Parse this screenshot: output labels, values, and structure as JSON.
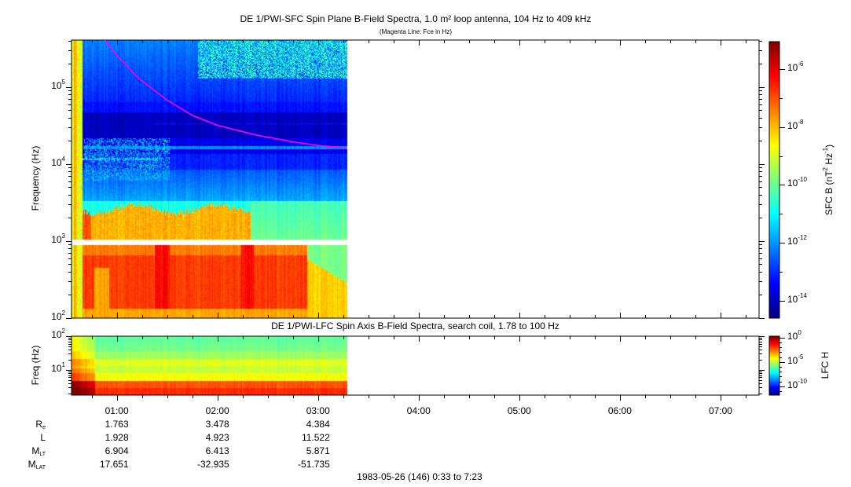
{
  "chart_data": [
    {
      "type": "heatmap",
      "title": "DE 1/PWI-SFC  Spin Plane B-Field Spectra, 1.0 m² loop antenna, 104 Hz to 409 kHz",
      "subtitle": "(Magenta Line: Fce in Hz)",
      "ylabel": "Frequency (Hz)",
      "yscale": "log",
      "ylim": [
        100,
        409000
      ],
      "yticks": [
        {
          "base": "10",
          "exp": "2",
          "value": 100
        },
        {
          "base": "10",
          "exp": "3",
          "value": 1000
        },
        {
          "base": "10",
          "exp": "4",
          "value": 10000
        },
        {
          "base": "10",
          "exp": "5",
          "value": 100000
        }
      ],
      "data_time_range_hours": [
        0.55,
        3.29
      ],
      "colorbar": {
        "label": "SFC B (nT",
        "label_sup1": "2",
        "label_mid": " Hz",
        "label_sup2": "-1",
        "label_end": ")",
        "scale": "log",
        "range_log10": [
          -14.6,
          -5.05
        ],
        "ticks": [
          {
            "base": "10",
            "exp": "-6",
            "value": -6
          },
          {
            "base": "10",
            "exp": "-8",
            "value": -8
          },
          {
            "base": "10",
            "exp": "-10",
            "value": -10
          },
          {
            "base": "10",
            "exp": "-12",
            "value": -12
          },
          {
            "base": "10",
            "exp": "-14",
            "value": -14
          }
        ]
      },
      "fce_line": {
        "color": "#ff00ff",
        "time_hours": [
          0.88,
          1.0,
          1.22,
          1.5,
          1.75,
          2.0,
          2.38,
          2.75,
          3.0,
          3.28
        ],
        "freq_hz": [
          409000,
          260000,
          129000,
          68000,
          43000,
          32000,
          24000,
          19500,
          17500,
          16300
        ]
      }
    },
    {
      "type": "heatmap",
      "title": "DE 1/PWI-LFC  Spin Axis B-Field Spectra, search coil, 1.78 to 100 Hz",
      "ylabel": "Freq (Hz)",
      "yscale": "log",
      "ylim": [
        1.78,
        100
      ],
      "yticks": [
        {
          "base": "10",
          "exp": "1",
          "value": 10
        },
        {
          "base": "10",
          "exp": "2",
          "value": 100
        }
      ],
      "data_time_range_hours": [
        0.55,
        3.29
      ],
      "colorbar": {
        "label": "LFC H",
        "scale": "log",
        "range_log10": [
          0.3,
          -11.8
        ],
        "ticks": [
          {
            "base": "10",
            "exp": "0",
            "value": 0
          },
          {
            "base": "10",
            "exp": "-5",
            "value": -5
          },
          {
            "base": "10",
            "exp": "-10",
            "value": -10
          }
        ]
      }
    }
  ],
  "x_axis": {
    "range_hours": [
      0.55,
      7.383
    ],
    "ticks": [
      {
        "label": "01:00",
        "hour": 1
      },
      {
        "label": "02:00",
        "hour": 2
      },
      {
        "label": "03:00",
        "hour": 3
      },
      {
        "label": "04:00",
        "hour": 4
      },
      {
        "label": "05:00",
        "hour": 5
      },
      {
        "label": "06:00",
        "hour": 6
      },
      {
        "label": "07:00",
        "hour": 7
      }
    ],
    "minor_tick_minutes": 15
  },
  "ephemeris": [
    {
      "name": "R",
      "sub": "e",
      "values": [
        "1.763",
        "3.478",
        "4.384"
      ]
    },
    {
      "name": "L",
      "sub": "",
      "values": [
        "1.928",
        "4.923",
        "11.522"
      ]
    },
    {
      "name": "M",
      "sub": "LT",
      "values": [
        "6.904",
        "6.413",
        "5.871"
      ]
    },
    {
      "name": "M",
      "sub": "LAT",
      "values": [
        "17.651",
        "-32.935",
        "-51.735"
      ]
    }
  ],
  "footer": "1983-05-26 (146) 0:33 to 7:23"
}
